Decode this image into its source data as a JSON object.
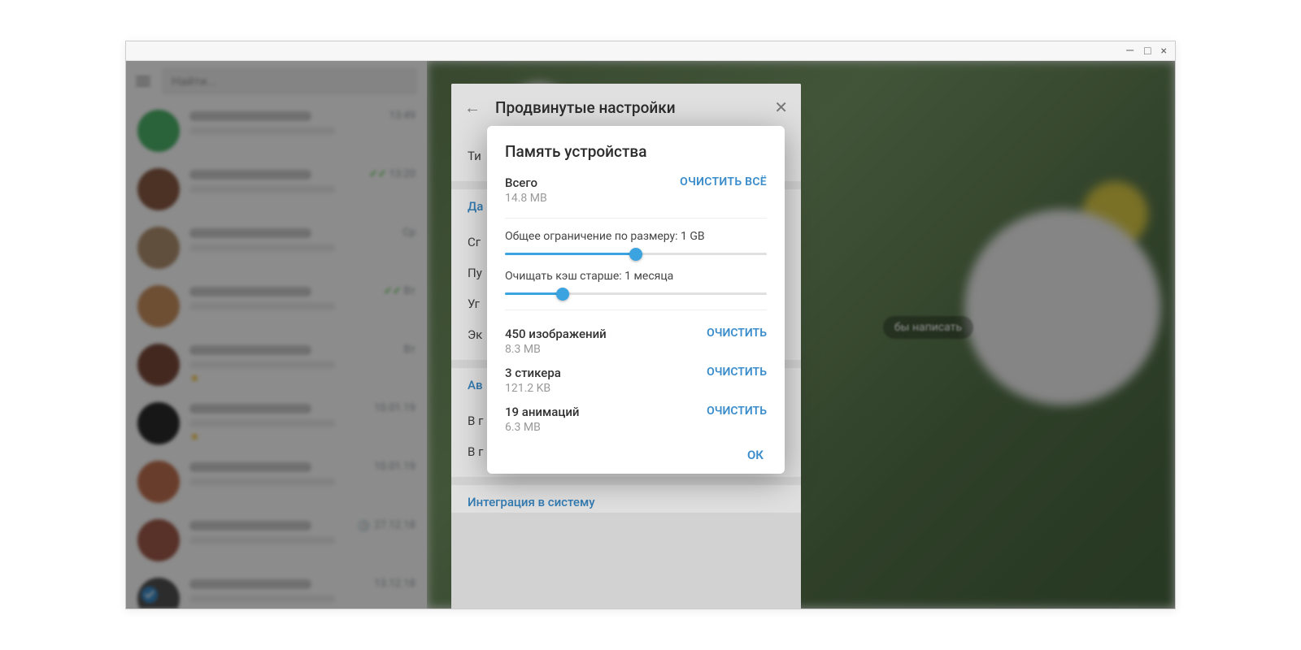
{
  "window": {
    "minimize": "—",
    "maximize": "□",
    "close": "×"
  },
  "sidebar": {
    "search_placeholder": "Найти...",
    "chats": [
      {
        "time": "13:49",
        "checks": false,
        "avatar": "#4db36a"
      },
      {
        "time": "13:20",
        "checks": true,
        "avatar": "#8a5a44"
      },
      {
        "time": "Ср",
        "checks": false,
        "avatar": "#b09070"
      },
      {
        "time": "Вт",
        "checks": true,
        "avatar": "#c89060"
      },
      {
        "time": "Вт",
        "checks": false,
        "avatar": "#7a4a3a",
        "star": true
      },
      {
        "time": "10.01.19",
        "checks": false,
        "avatar": "#2a2a2a",
        "star": true
      },
      {
        "time": "10.01.19",
        "checks": false,
        "avatar": "#c07050"
      },
      {
        "time": "27.12.18",
        "checks": false,
        "avatar": "#a05a4a",
        "clock": true
      },
      {
        "time": "13.12.18",
        "checks": false,
        "avatar": "#505050"
      }
    ]
  },
  "main": {
    "hint_partial": "бы написать"
  },
  "settings_panel": {
    "title": "Продвинутые настройки",
    "items_top": [
      "Ти",
      "Да",
      "Сг",
      "Пу",
      "Уг",
      "Эк"
    ],
    "section_auto": "Ав",
    "items_auto": [
      "В г",
      "В г"
    ],
    "section_integration": "Интеграция в систему"
  },
  "memory_dialog": {
    "title": "Память устройства",
    "total_label": "Всего",
    "total_value": "14.8 MB",
    "clear_all": "ОЧИСТИТЬ ВСЁ",
    "size_limit": {
      "label": "Общее ограничение по размеру: 1 GB",
      "fill_pct": 50
    },
    "cache_age": {
      "label": "Очищать кэш старше: 1 месяца",
      "fill_pct": 22
    },
    "items": [
      {
        "title": "450 изображений",
        "size": "8.3 MB"
      },
      {
        "title": "3 стикера",
        "size": "121.2 KB"
      },
      {
        "title": "19 анимаций",
        "size": "6.3 MB"
      }
    ],
    "clear_btn": "ОЧИСТИТЬ",
    "ok_btn": "ОК"
  }
}
